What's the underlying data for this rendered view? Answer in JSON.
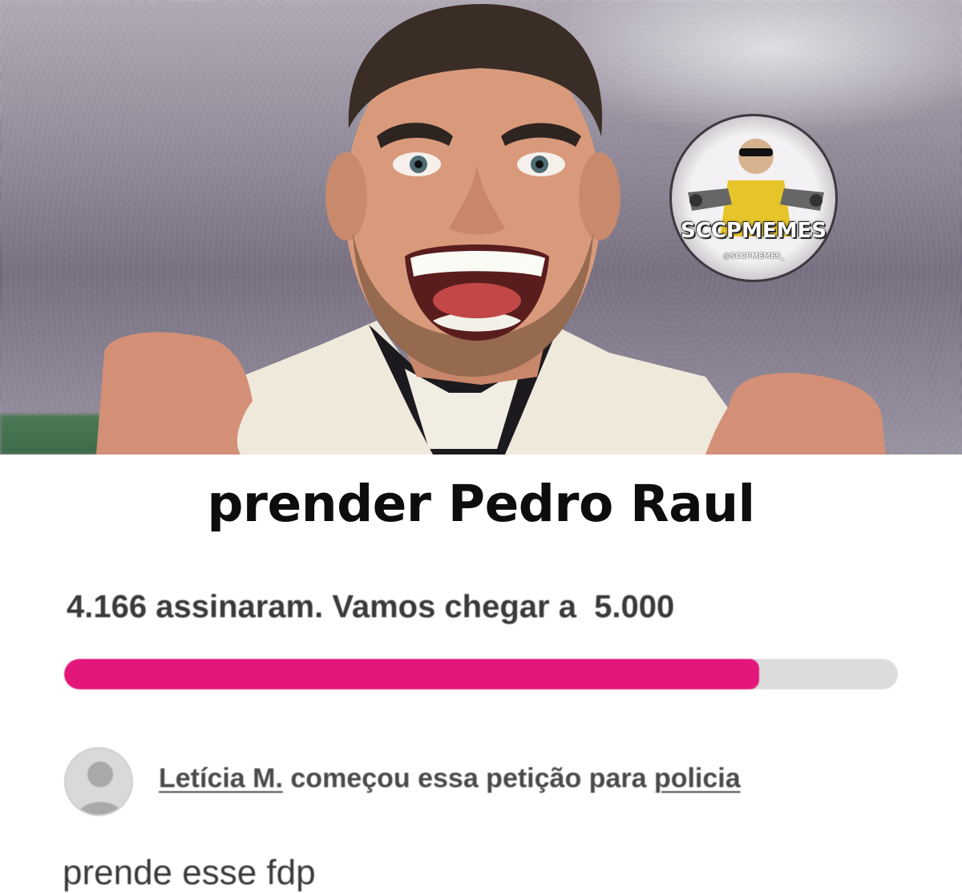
{
  "photo": {
    "icon": "celebrating-player-photo",
    "watermark": {
      "title": "SCCPMEMES",
      "handle": "@SCCPMEMES_"
    }
  },
  "caption": "prender Pedro Raul",
  "petition": {
    "signed_text": "4.166 assinaram. Vamos chegar a  5.000",
    "signatures": 4166,
    "goal": 5000,
    "progress_fraction": 0.8332,
    "progress_color": "#e3177a",
    "track_color": "#dcdcdc",
    "starter": {
      "avatar_icon": "default-user-avatar-icon",
      "name": "Letícia M.",
      "middle": "começou essa petição para",
      "target": "policia"
    },
    "body": "prende esse fdp"
  }
}
